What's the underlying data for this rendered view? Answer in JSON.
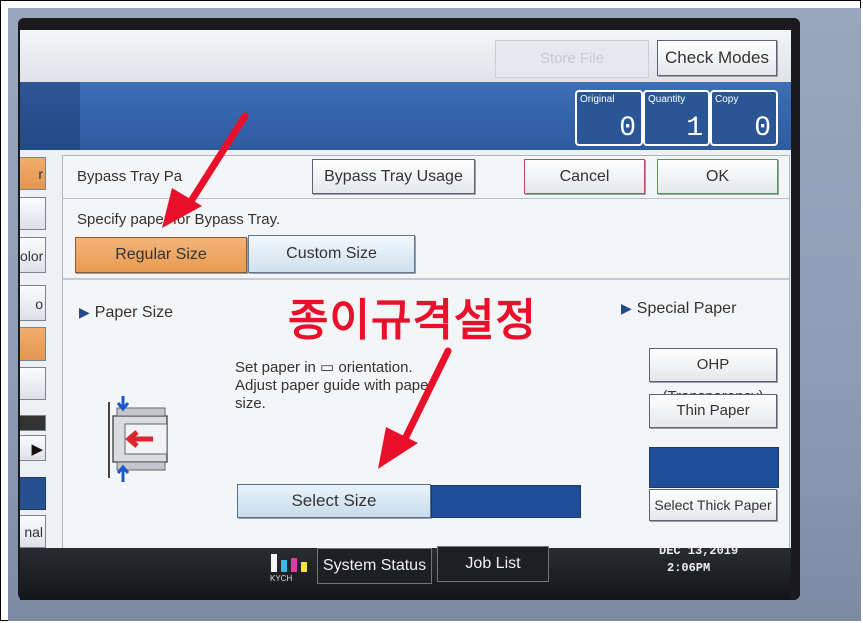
{
  "header": {
    "disabled_button": "Store File",
    "check_modes": "Check Modes",
    "counters": [
      {
        "label": "Original",
        "value": "0"
      },
      {
        "label": "Quantity",
        "value": "1"
      },
      {
        "label": "Copy",
        "value": "0"
      }
    ]
  },
  "left_strip": [
    "r",
    "",
    "olor",
    "o",
    "",
    "",
    "",
    "",
    "nal"
  ],
  "dialog": {
    "title": "Bypass Tray Pa",
    "buttons": {
      "usage": "Bypass Tray Usage",
      "cancel": "Cancel",
      "ok": "OK"
    },
    "instruction": "Specify paper for Bypass Tray.",
    "tabs": {
      "regular": "Regular Size",
      "custom": "Custom Size"
    },
    "paper_size_heading": "Paper Size",
    "special_paper_heading": "Special Paper",
    "annotation": "종이규격설정",
    "orientation_lines": [
      "Set paper in ▭ orientation.",
      "Adjust paper guide with paper",
      "size."
    ],
    "select_size": "Select Size",
    "special_buttons": {
      "ohp": "OHP (Transparency)",
      "thin": "Thin Paper",
      "thick": "Select Thick Paper"
    }
  },
  "taskbar": {
    "kych_letters": "KYCH",
    "system_status": "System Status",
    "job_list": "Job List",
    "date": "DEC  13,2019",
    "time": "2:06PM"
  },
  "colors": {
    "accent_blue": "#2e5aa0",
    "selected_tab": "#e79b52",
    "annotation_red": "#e8102a"
  }
}
